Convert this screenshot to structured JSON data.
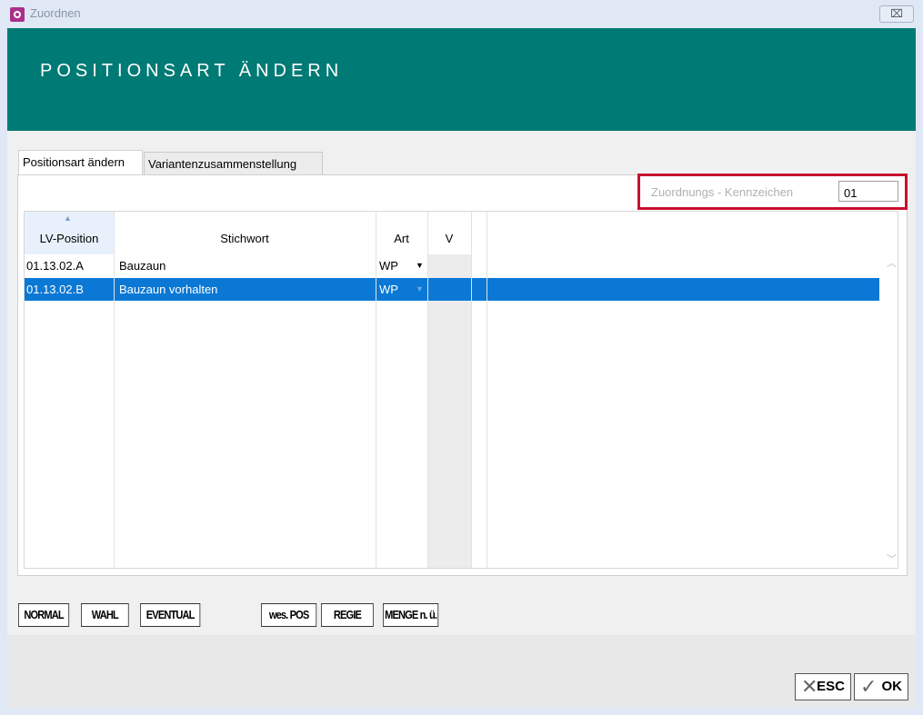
{
  "window": {
    "title": "Zuordnen",
    "close_label": "⌧"
  },
  "banner": {
    "title": "POSITIONSART ÄNDERN"
  },
  "tabs": [
    {
      "label": "Positionsart ändern",
      "active": true
    },
    {
      "label": "Variantenzusammenstellung",
      "active": false
    }
  ],
  "kennzeichen": {
    "label": "Zuordnungs - Kennzeichen",
    "value": "01"
  },
  "grid": {
    "columns": [
      "LV-Position",
      "Stichwort",
      "Art",
      "V"
    ],
    "rows": [
      {
        "position": "01.13.02.A",
        "stichwort": "Bauzaun",
        "art": "WP",
        "selected": false
      },
      {
        "position": "01.13.02.B",
        "stichwort": "Bauzaun vorhalten",
        "art": "WP",
        "selected": true
      }
    ]
  },
  "position_buttons": [
    "NORMAL",
    "WAHL",
    "EVENTUAL",
    "wes. POS",
    "REGIE",
    "MENGE n. ü."
  ],
  "footer": {
    "esc_label": "ESC",
    "ok_label": "OK"
  },
  "colors": {
    "banner": "#007a74",
    "selection": "#0a78d4",
    "highlight": "#c8102e"
  }
}
